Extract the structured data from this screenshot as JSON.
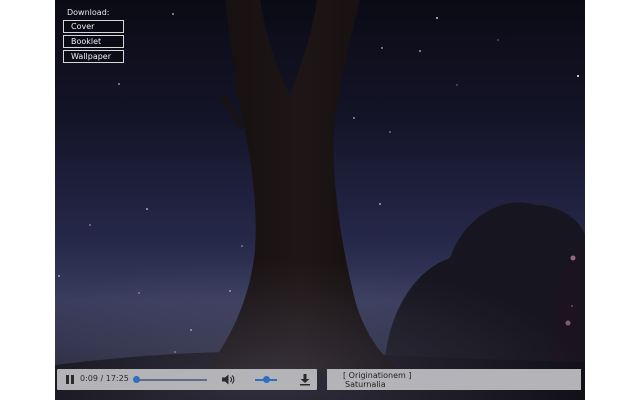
{
  "download": {
    "title": "Download:",
    "buttons": [
      "Cover",
      "Booklet",
      "Wallpaper"
    ]
  },
  "player": {
    "time": "0:09 / 17:25",
    "progress_fraction": 0.009,
    "volume_fraction": 0.55,
    "icons": {
      "pause": "pause-icon",
      "volume": "volume-icon",
      "download": "download-icon"
    }
  },
  "track": {
    "album": "[ Originationem ]",
    "title": "Saturnalia"
  },
  "colors": {
    "accent": "#2f6fbf",
    "bar": "#b4b4b8"
  }
}
